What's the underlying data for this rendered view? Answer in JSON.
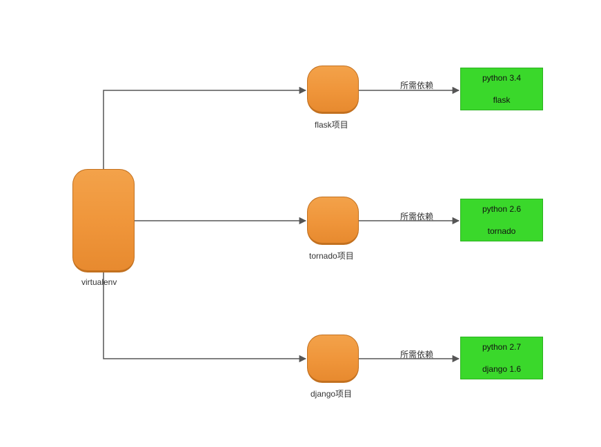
{
  "root": {
    "label": "virtualenv"
  },
  "projects": [
    {
      "label": "flask项目",
      "edge_label": "所需依赖",
      "deps": [
        "python 3.4",
        "flask"
      ]
    },
    {
      "label": "tornado项目",
      "edge_label": "所需依赖",
      "deps": [
        "python 2.6",
        "tornado"
      ]
    },
    {
      "label": "django项目",
      "edge_label": "所需依赖",
      "deps": [
        "python 2.7",
        "django 1.6"
      ]
    }
  ],
  "colors": {
    "node_orange": "#ef953a",
    "node_orange_border": "#c2701f",
    "dep_green": "#3ad82b",
    "dep_green_border": "#2ab11e",
    "wire": "#555555"
  }
}
